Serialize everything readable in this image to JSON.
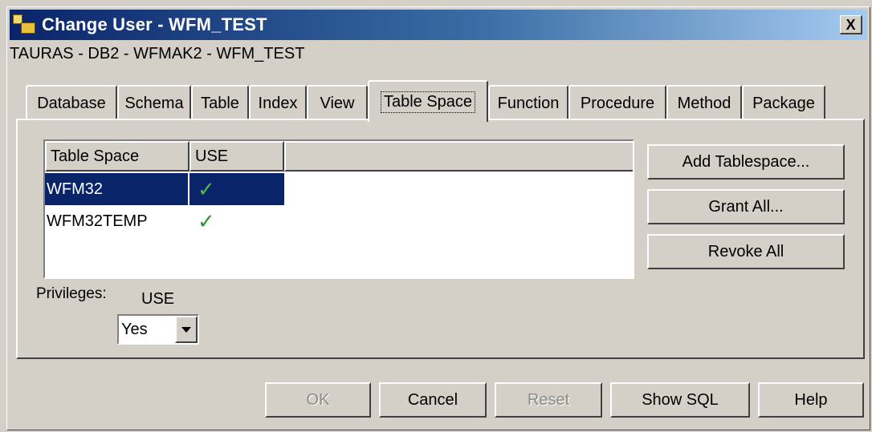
{
  "window": {
    "title": "Change User - WFM_TEST",
    "close_label": "X",
    "icon": "app-users-icon"
  },
  "breadcrumb": "TAURAS - DB2 - WFMAK2 - WFM_TEST",
  "tabs": [
    {
      "label": "Database",
      "active": false
    },
    {
      "label": "Schema",
      "active": false
    },
    {
      "label": "Table",
      "active": false
    },
    {
      "label": "Index",
      "active": false
    },
    {
      "label": "View",
      "active": false
    },
    {
      "label": "Table Space",
      "active": true
    },
    {
      "label": "Function",
      "active": false
    },
    {
      "label": "Procedure",
      "active": false
    },
    {
      "label": "Method",
      "active": false
    },
    {
      "label": "Package",
      "active": false
    }
  ],
  "tablespace_list": {
    "columns": [
      "Table Space",
      "USE"
    ],
    "rows": [
      {
        "name": "WFM32",
        "use": "✓",
        "selected": true
      },
      {
        "name": "WFM32TEMP",
        "use": "✓",
        "selected": false
      }
    ]
  },
  "side_buttons": {
    "add": "Add Tablespace...",
    "grant": "Grant All...",
    "revoke": "Revoke All"
  },
  "privileges": {
    "label": "Privileges:",
    "use_label": "USE",
    "use_value": "Yes"
  },
  "footer_buttons": {
    "ok": "OK",
    "cancel": "Cancel",
    "reset": "Reset",
    "show_sql": "Show SQL",
    "help": "Help"
  },
  "colors": {
    "titlebar_start": "#0a246a",
    "titlebar_end": "#a6caf0",
    "face": "#d4d0c8",
    "selection": "#0a246a",
    "check": "#2a9a2a"
  }
}
